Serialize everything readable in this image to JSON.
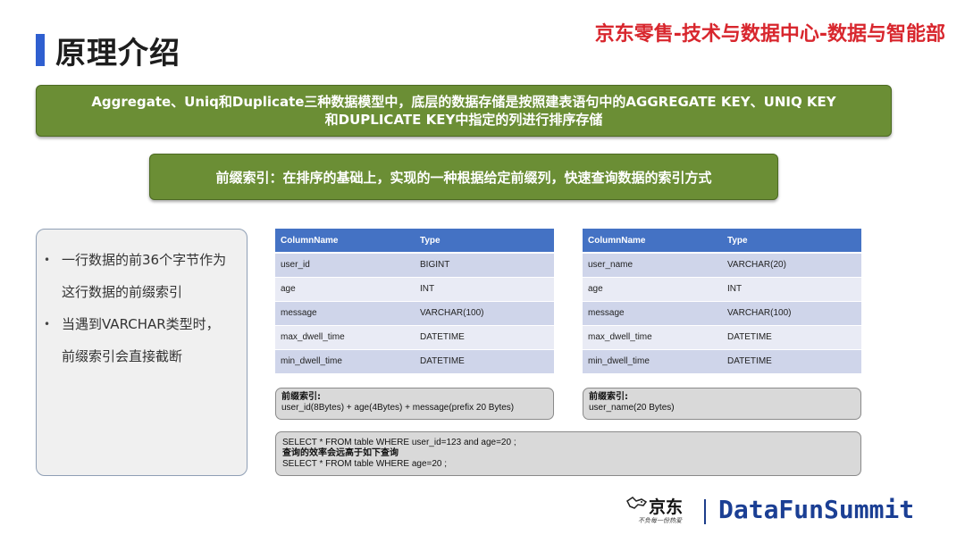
{
  "header": {
    "title": "原理介绍",
    "org": "京东零售-技术与数据中心-数据与智能部"
  },
  "banners": {
    "main_line1": "Aggregate、Uniq和Duplicate三种数据模型中，底层的数据存储是按照建表语句中的AGGREGATE KEY、UNIQ KEY",
    "main_line2": "和DUPLICATE KEY中指定的列进行排序存储",
    "sub": "前缀索引：在排序的基础上，实现的一种根据给定前缀列，快速查询数据的索引方式"
  },
  "notes": {
    "bullet": "•",
    "items": [
      "一行数据的前36个字节作为",
      "这行数据的前缀索引",
      "当遇到VARCHAR类型时，",
      "前缀索引会直接截断"
    ]
  },
  "table_left": {
    "headers": [
      "ColumnName",
      "Type"
    ],
    "rows": [
      [
        "user_id",
        "BIGINT"
      ],
      [
        "age",
        "INT"
      ],
      [
        "message",
        "VARCHAR(100)"
      ],
      [
        "max_dwell_time",
        "DATETIME"
      ],
      [
        "min_dwell_time",
        "DATETIME"
      ]
    ]
  },
  "table_right": {
    "headers": [
      "ColumnName",
      "Type"
    ],
    "rows": [
      [
        "user_name",
        "VARCHAR(20)"
      ],
      [
        "age",
        "INT"
      ],
      [
        "message",
        "VARCHAR(100)"
      ],
      [
        "max_dwell_time",
        "DATETIME"
      ],
      [
        "min_dwell_time",
        "DATETIME"
      ]
    ]
  },
  "prefix_left": {
    "label": "前缀索引:",
    "value": "user_id(8Bytes) + age(4Bytes) + message(prefix 20 Bytes)"
  },
  "prefix_right": {
    "label": "前缀索引:",
    "value": " user_name(20 Bytes)"
  },
  "query": {
    "line1": "SELECT * FROM table WHERE user_id=123 and age=20 ;",
    "line2": "查询的效率会远高于如下查询",
    "line3": "SELECT * FROM table WHERE age=20 ;"
  },
  "footer": {
    "jd_logo_text": "京东",
    "jd_slogan": "不负每一份热爱",
    "brand": "DataFunSummit"
  },
  "colors": {
    "accent_blue": "#2f5fd0",
    "org_red": "#d8262d",
    "banner_green": "#6b8e35",
    "table_header": "#4472c4",
    "brand_blue": "#1b3f94"
  }
}
